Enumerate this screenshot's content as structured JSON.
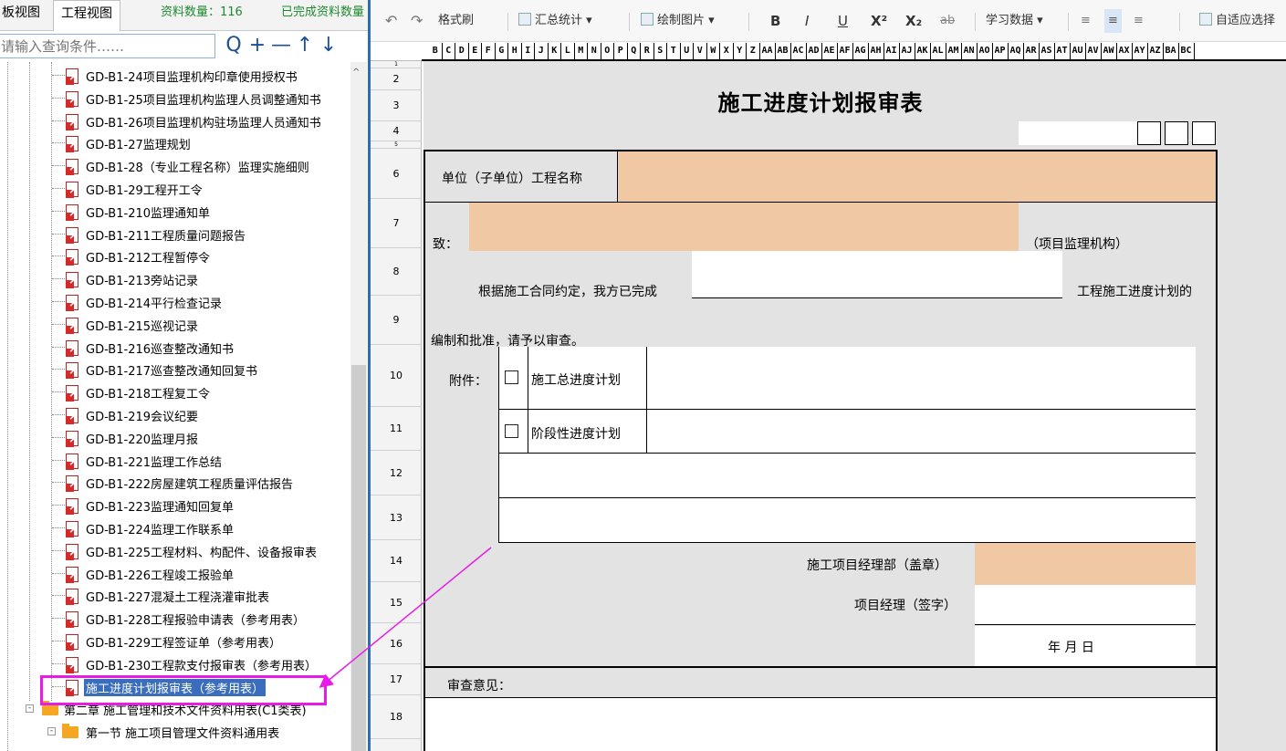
{
  "left_panel": {
    "tabs": [
      "板视图",
      "工程视图"
    ],
    "stats": {
      "count_label": "资料数量：116",
      "done_label": "已完成资料数量"
    },
    "search_placeholder": "请输入查询条件……",
    "search_buttons": {
      "search": "Q",
      "add": "+",
      "remove": "—",
      "up": "↑",
      "down": "↓"
    },
    "tree_items": [
      "GD-B1-24项目监理机构印章使用授权书",
      "GD-B1-25项目监理机构监理人员调整通知书",
      "GD-B1-26项目监理机构驻场监理人员通知书",
      "GD-B1-27监理规划",
      "GD-B1-28（专业工程名称）监理实施细则",
      "GD-B1-29工程开工令",
      "GD-B1-210监理通知单",
      "GD-B1-211工程质量问题报告",
      "GD-B1-212工程暂停令",
      "GD-B1-213旁站记录",
      "GD-B1-214平行检查记录",
      "GD-B1-215巡视记录",
      "GD-B1-216巡查整改通知书",
      "GD-B1-217巡查整改通知回复书",
      "GD-B1-218工程复工令",
      "GD-B1-219会议纪要",
      "GD-B1-220监理月报",
      "GD-B1-221监理工作总结",
      "GD-B1-222房屋建筑工程质量评估报告",
      "GD-B1-223监理通知回复单",
      "GD-B1-224监理工作联系单",
      "GD-B1-225工程材料、构配件、设备报审表",
      "GD-B1-226工程竣工报验单",
      "GD-B1-227混凝土工程浇灌审批表",
      "GD-B1-228工程报验申请表（参考用表）",
      "GD-B1-229工程签证单（参考用表）",
      "GD-B1-230工程款支付报审表（参考用表）",
      "施工进度计划报审表（参考用表）"
    ],
    "selected_index": 27,
    "chapter": "第二章 施工管理和技术文件资料用表(C1类表)",
    "section": "第一节 施工项目管理文件资料通用表"
  },
  "toolbar": {
    "format_brush": "格式刷",
    "summary": "汇总统计",
    "draw": "绘制图片",
    "bold": "B",
    "italic": "I",
    "underline": "U",
    "superscript": "X²",
    "subscript": "X₂",
    "strike": "ab",
    "study": "学习数据",
    "autofit": "自适应选择"
  },
  "sheet": {
    "columns": [
      "B",
      "C",
      "D",
      "E",
      "F",
      "G",
      "H",
      "I",
      "J",
      "K",
      "L",
      "M",
      "N",
      "O",
      "P",
      "Q",
      "R",
      "S",
      "T",
      "U",
      "V",
      "W",
      "X",
      "Y",
      "Z",
      "AA",
      "AB",
      "AC",
      "AD",
      "AE",
      "AF",
      "AG",
      "AH",
      "AI",
      "AJ",
      "AK",
      "AL",
      "AM",
      "AN",
      "AO",
      "AP",
      "AQ",
      "AR",
      "AS",
      "AT",
      "AU",
      "AV",
      "AW",
      "AX",
      "AY",
      "AZ",
      "BA",
      "BC"
    ],
    "rows": [
      "1",
      "2",
      "3",
      "4",
      "5",
      "6",
      "7",
      "8",
      "9",
      "10",
      "11",
      "12",
      "13",
      "14",
      "15",
      "16",
      "17",
      "18"
    ],
    "title": "施工进度计划报审表",
    "labels": {
      "project_name": "单位（子单位）工程名称",
      "to": "致：",
      "supervision_org": "（项目监理机构）",
      "contract_text": "根据施工合同约定，我方已完成",
      "plan_text": "工程施工进度计划的",
      "approve_text": "编制和批准，请予以审查。",
      "attachment": "附件：",
      "opt1": "施工总进度计划",
      "opt2": "阶段性进度计划",
      "dept_seal": "施工项目经理部（盖章）",
      "manager_sign": "项目经理（签字）",
      "date": "年   月   日",
      "review": "审查意见："
    }
  },
  "colors": {
    "peach": "#f0c8a4",
    "accent": "#2d6bbf",
    "annotation": "#e81ce8",
    "stat_green": "#1f8a2f"
  }
}
